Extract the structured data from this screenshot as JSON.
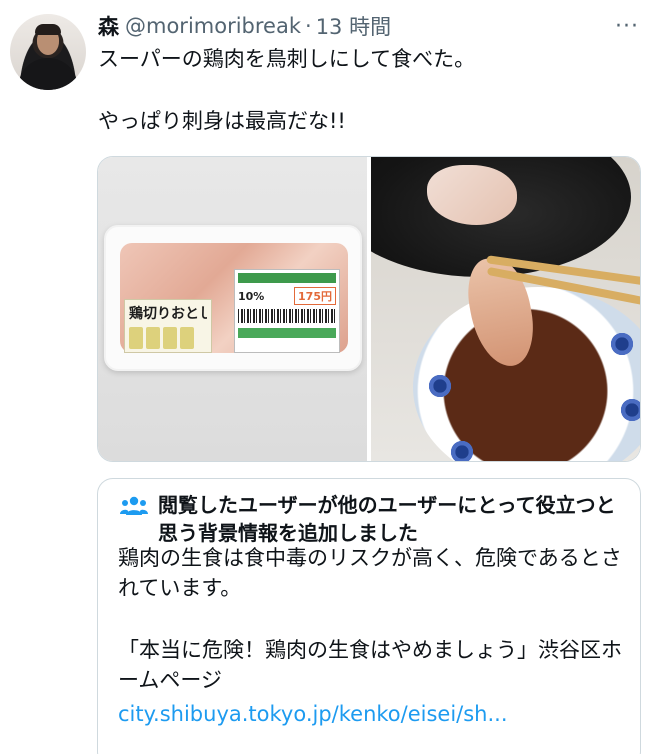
{
  "tweet": {
    "display_name": "森",
    "handle": "@morimoribreak",
    "separator": "·",
    "time": "13 時間",
    "text": "スーパーの鶏肉を鳥刺しにして食べた。\n\nやっぱり刺身は最高だな!!",
    "more_glyph": "···"
  },
  "media": {
    "left_photo_label": "鶏切りおとし",
    "left_photo_price_pct": "10%",
    "left_photo_price": "175円",
    "icons": {
      "more": "more-icon",
      "community_notes": "people-icon"
    }
  },
  "community_note": {
    "header": "閲覧したユーザーが他のユーザーにとって役立つと思う背景情報を追加しました",
    "body": "鶏肉の生食は食中毒のリスクが高く、危険であるとされています。",
    "source": "「本当に危険！鶏肉の生食はやめましょう」渋谷区ホームページ",
    "link": "city.shibuya.tokyo.jp/kenko/eisei/sh..."
  },
  "colors": {
    "link": "#1d9bf0",
    "muted": "#536471",
    "border": "#cfd9de"
  }
}
